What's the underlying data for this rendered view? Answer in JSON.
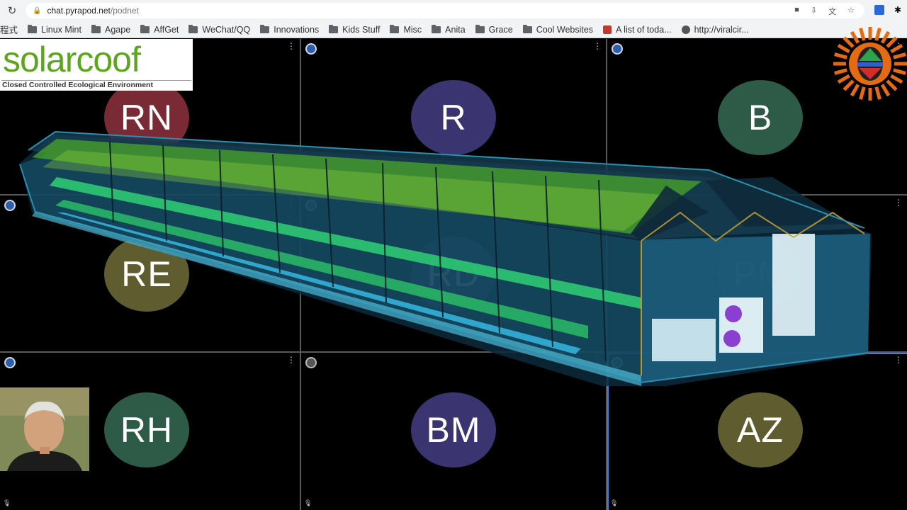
{
  "browser": {
    "url_host": "chat.pyrapod.net",
    "url_path": "/podnet"
  },
  "bookmarks": [
    {
      "label": "程式",
      "kind": "partial"
    },
    {
      "label": "Linux Mint",
      "kind": "folder"
    },
    {
      "label": "Agape",
      "kind": "folder"
    },
    {
      "label": "AffGet",
      "kind": "folder"
    },
    {
      "label": "WeChat/QQ",
      "kind": "folder"
    },
    {
      "label": "Innovations",
      "kind": "folder"
    },
    {
      "label": "Kids Stuff",
      "kind": "folder"
    },
    {
      "label": "Misc",
      "kind": "folder"
    },
    {
      "label": "Anita",
      "kind": "folder"
    },
    {
      "label": "Grace",
      "kind": "folder"
    },
    {
      "label": "Cool Websites",
      "kind": "folder"
    },
    {
      "label": "A list of toda...",
      "kind": "site"
    },
    {
      "label": "http://viralcir...",
      "kind": "globe"
    }
  ],
  "logo": {
    "brand": "solarcoof",
    "tagline": "Closed Controlled Ecological Environment"
  },
  "participants": [
    {
      "initials": "RN",
      "color": "#7a2a34"
    },
    {
      "initials": "R",
      "color": "#3a3470"
    },
    {
      "initials": "B",
      "color": "#2e5a48"
    },
    {
      "initials": "RE",
      "color": "#5f5c30"
    },
    {
      "initials": "RD",
      "color": "#3a3470"
    },
    {
      "initials": "PM",
      "color": "#2e5a48"
    },
    {
      "initials": "RH",
      "color": "#2e5a48"
    },
    {
      "initials": "BM",
      "color": "#3a3470"
    },
    {
      "initials": "AZ",
      "color": "#5f5c30"
    }
  ],
  "colors": {
    "greenhouse_frame": "#2a8fb0",
    "greenhouse_glass": "#7fe0ff",
    "plant_green": "#3f9a2a",
    "tray_green": "#2fcf6a",
    "active_speaker": "#3c7ee8"
  }
}
